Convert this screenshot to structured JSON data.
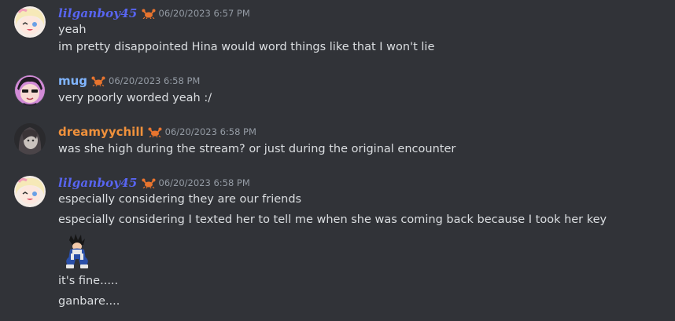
{
  "colors": {
    "background": "#313338",
    "text": "#dbdee1",
    "timestamp": "#949ba4",
    "user_blue": "#5865f2",
    "user_lightblue": "#80b5ff",
    "user_orange": "#f0913c"
  },
  "messages": [
    {
      "username": "lilganboy45",
      "timestamp": "06/20/2023 6:57 PM",
      "lines": [
        "yeah",
        "im pretty disappointed Hina would word things like that I won't lie"
      ]
    },
    {
      "username": "mug",
      "timestamp": "06/20/2023 6:58 PM",
      "lines": [
        "very poorly worded yeah :/"
      ]
    },
    {
      "username": "dreamyychill",
      "timestamp": "06/20/2023 6:58 PM",
      "lines": [
        "was she high during the stream? or just during the original encounter"
      ]
    },
    {
      "username": "lilganboy45",
      "timestamp": "06/20/2023 6:58 PM",
      "lines": [
        "especially considering they are our friends",
        "especially considering I texted her to tell me when she was coming back because I took her key",
        "it's fine.....",
        "ganbare...."
      ],
      "sticker": "vegeta-sticker"
    }
  ],
  "icons": {
    "badge": "crab-badge-icon"
  }
}
